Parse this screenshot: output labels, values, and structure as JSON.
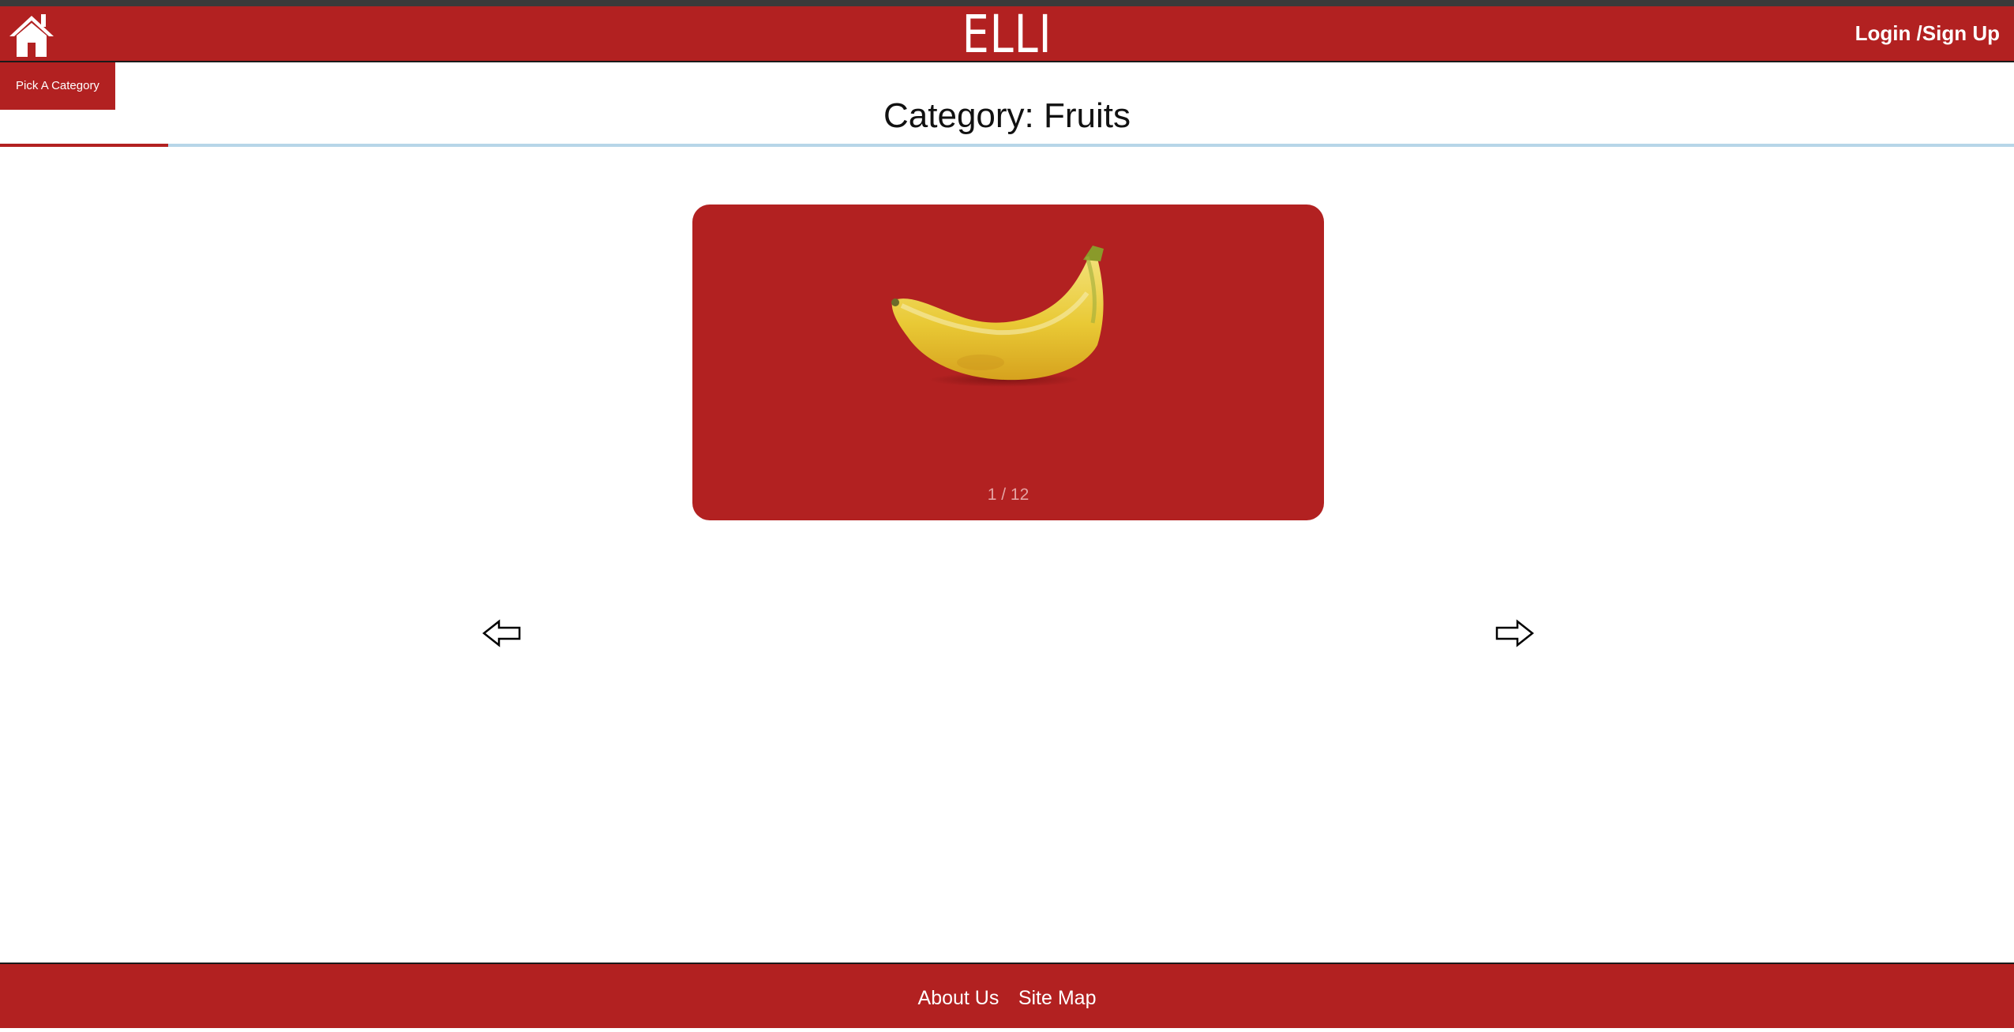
{
  "header": {
    "brand": "ELLI",
    "login_label": "Login /Sign Up"
  },
  "nav": {
    "pick_category_label": "Pick A Category"
  },
  "page": {
    "title": "Category: Fruits"
  },
  "flashcard": {
    "image_subject": "banana",
    "counter": "1 / 12",
    "current": 1,
    "total": 12
  },
  "icons": {
    "home": "home-icon",
    "prev": "arrow-left-icon",
    "next": "arrow-right-icon"
  },
  "footer": {
    "links": [
      "About Us",
      "Site Map"
    ]
  },
  "colors": {
    "brand_red": "#b22121",
    "progress_track": "#b7d6e8"
  }
}
